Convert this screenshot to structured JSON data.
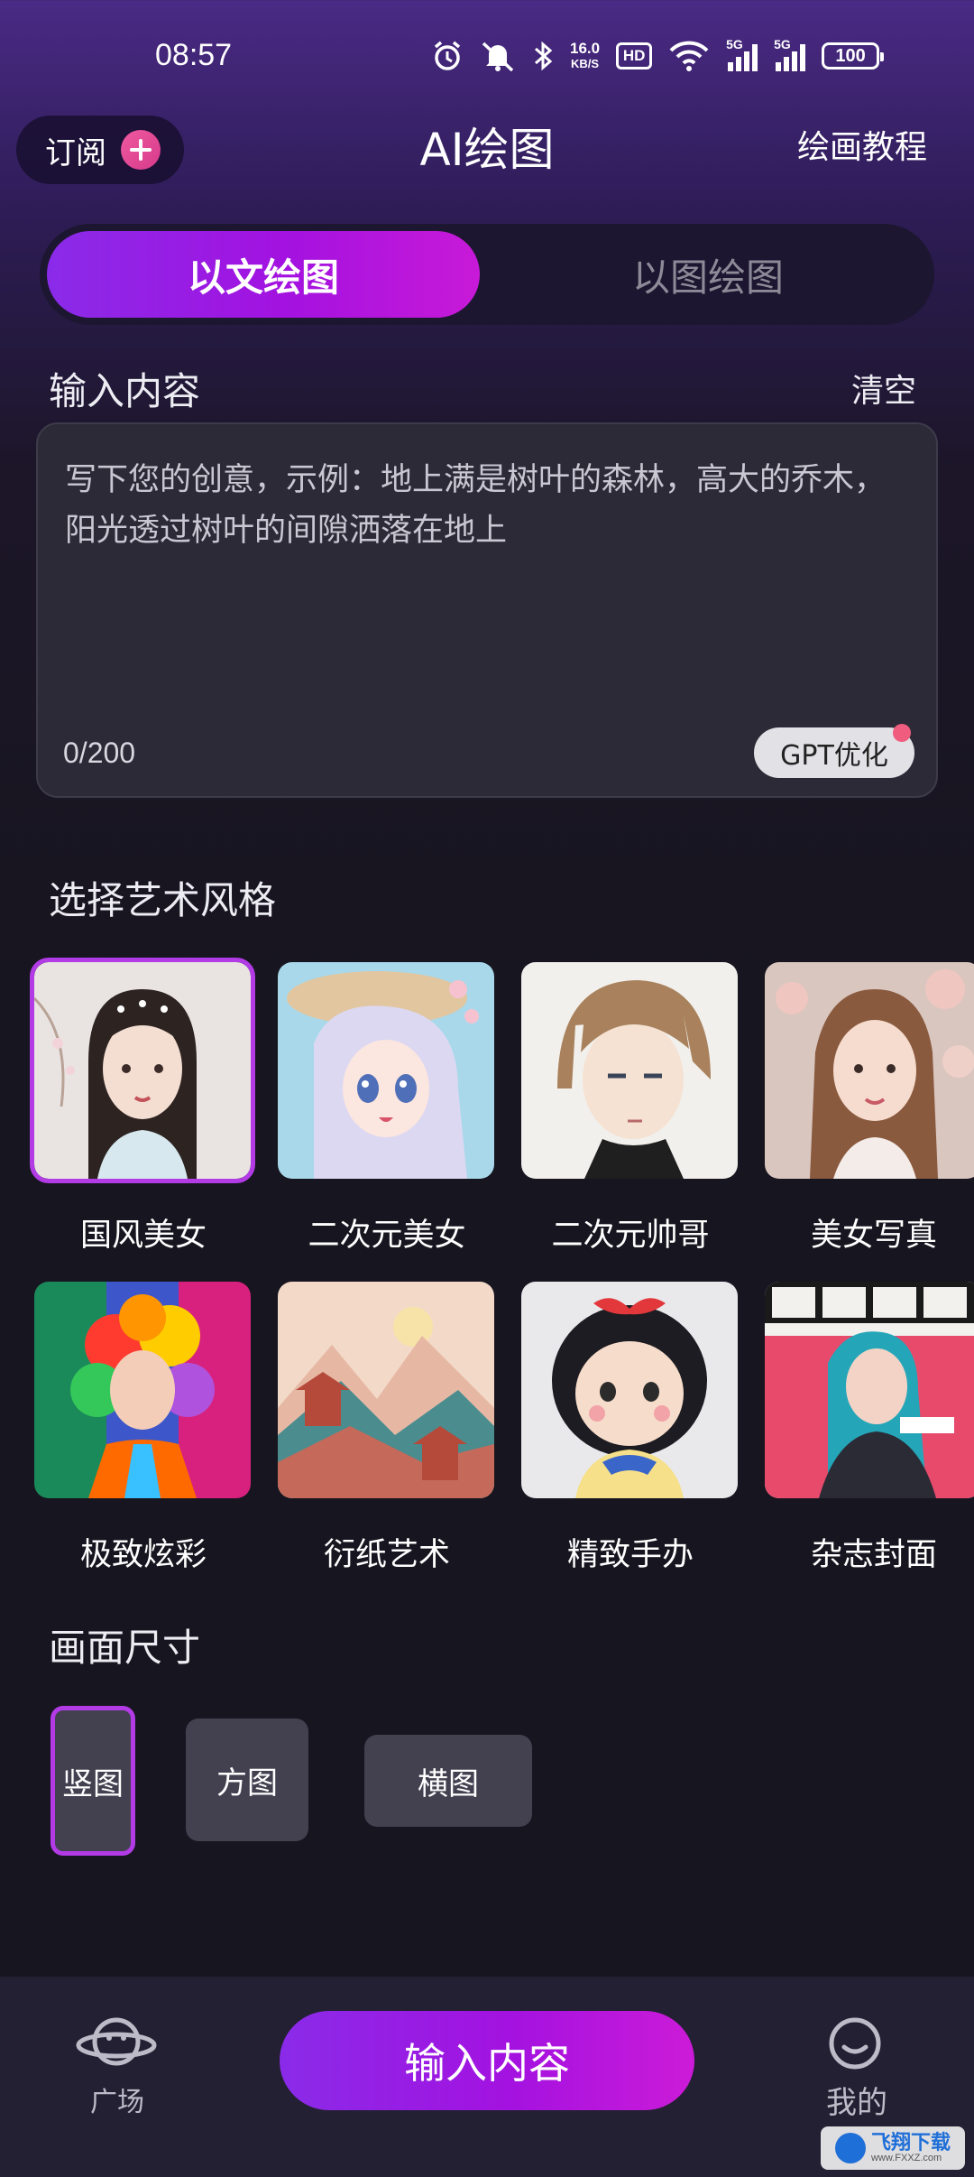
{
  "status_bar": {
    "time": "08:57",
    "net_speed_value": "16.0",
    "net_speed_unit": "KB/S",
    "hd_label": "HD",
    "signal1_label": "5G",
    "signal2_label": "5G",
    "battery": "100",
    "icons": [
      "alarm-icon",
      "mute-icon",
      "bluetooth-icon",
      "wifi-icon",
      "signal-icon",
      "battery-icon"
    ]
  },
  "header": {
    "subscribe_label": "订阅",
    "title": "AI绘图",
    "tutorial_label": "绘画教程"
  },
  "mode_tabs": [
    {
      "label": "以文绘图",
      "active": true
    },
    {
      "label": "以图绘图",
      "active": false
    }
  ],
  "input": {
    "section_label": "输入内容",
    "clear_label": "清空",
    "placeholder": "写下您的创意，示例：地上满是树叶的森林，高大的乔木，阳光透过树叶的间隙洒落在地上",
    "char_count": "0/200",
    "gpt_label": "GPT优化"
  },
  "styles": {
    "section_label": "选择艺术风格",
    "items": [
      {
        "label": "国风美女",
        "selected": true
      },
      {
        "label": "二次元美女",
        "selected": false
      },
      {
        "label": "二次元帅哥",
        "selected": false
      },
      {
        "label": "美女写真",
        "selected": false
      },
      {
        "label": "极致炫彩",
        "selected": false
      },
      {
        "label": "衍纸艺术",
        "selected": false
      },
      {
        "label": "精致手办",
        "selected": false
      },
      {
        "label": "杂志封面",
        "selected": false
      }
    ]
  },
  "size": {
    "section_label": "画面尺寸",
    "options": [
      {
        "label": "竖图",
        "selected": true
      },
      {
        "label": "方图",
        "selected": false
      },
      {
        "label": "横图",
        "selected": false
      }
    ]
  },
  "bottom_nav": {
    "plaza_label": "广场",
    "cta_label": "输入内容",
    "mine_label": "我的"
  },
  "watermark": {
    "cn": "飞翔下载",
    "en": "www.FXXZ.com"
  },
  "colors": {
    "accent_purple": "#a312e0",
    "selected_outline": "#b23be6",
    "background": "#17151f"
  }
}
